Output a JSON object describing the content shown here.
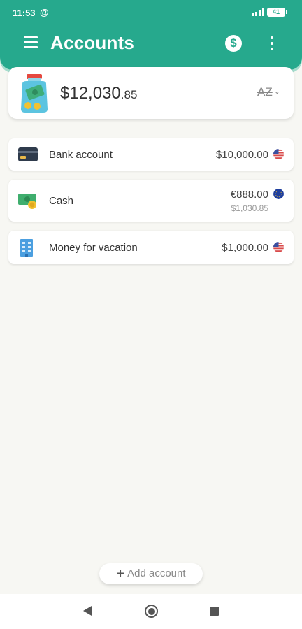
{
  "status": {
    "time": "11:53",
    "at_symbol": "@",
    "battery": "41"
  },
  "header": {
    "title": "Accounts",
    "currency_symbol": "$"
  },
  "summary": {
    "total_main": "$12,030",
    "total_cents": ".85",
    "sort_label": "AZ"
  },
  "accounts": [
    {
      "name": "Bank account",
      "amount": "$10,000.00",
      "icon": "bank-card-icon",
      "flag": "us-flag-icon"
    },
    {
      "name": "Cash",
      "amount": "€888.00",
      "converted": "$1,030.85",
      "icon": "cash-icon",
      "flag": "eu-flag-icon"
    },
    {
      "name": "Money for vacation",
      "amount": "$1,000.00",
      "icon": "building-icon",
      "flag": "us-flag-icon"
    }
  ],
  "add_button": {
    "label": "Add account"
  },
  "colors": {
    "primary": "#26a98d",
    "background": "#f7f7f3"
  }
}
